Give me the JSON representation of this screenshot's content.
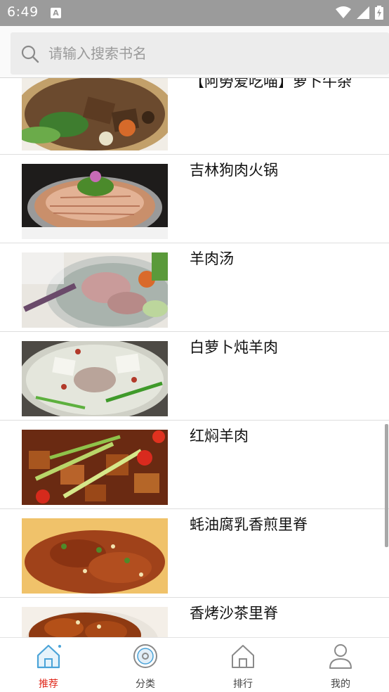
{
  "status_bar": {
    "time": "6:49",
    "notification_icon": "a-square-icon",
    "icons": [
      "wifi-icon",
      "signal-icon",
      "battery-charging-icon"
    ]
  },
  "search": {
    "placeholder": "请输入搜索书名",
    "value": ""
  },
  "recipes": [
    {
      "title": "【阿勞爱吃喵】萝卜牛杂",
      "image": "beef-radish-stew-image"
    },
    {
      "title": "吉林狗肉火锅",
      "image": "meat-hotpot-image"
    },
    {
      "title": "羊肉汤",
      "image": "lamb-soup-image"
    },
    {
      "title": "白萝卜炖羊肉",
      "image": "radish-lamb-stew-image"
    },
    {
      "title": "红焖羊肉",
      "image": "braised-lamb-image"
    },
    {
      "title": "蚝油腐乳香煎里脊",
      "image": "fried-tenderloin-image"
    },
    {
      "title": "香烤沙茶里脊",
      "image": "satay-tenderloin-image"
    }
  ],
  "bottom_nav": {
    "active": "推荐",
    "items": [
      {
        "label": "推荐",
        "icon": "home-recommend-icon"
      },
      {
        "label": "分类",
        "icon": "category-disc-icon"
      },
      {
        "label": "排行",
        "icon": "ranking-house-icon"
      },
      {
        "label": "我的",
        "icon": "profile-person-icon"
      }
    ]
  },
  "colors": {
    "active_nav": "#e0271a",
    "icon_blue": "#4aa3d8",
    "status_bar": "#9b9b9b"
  }
}
